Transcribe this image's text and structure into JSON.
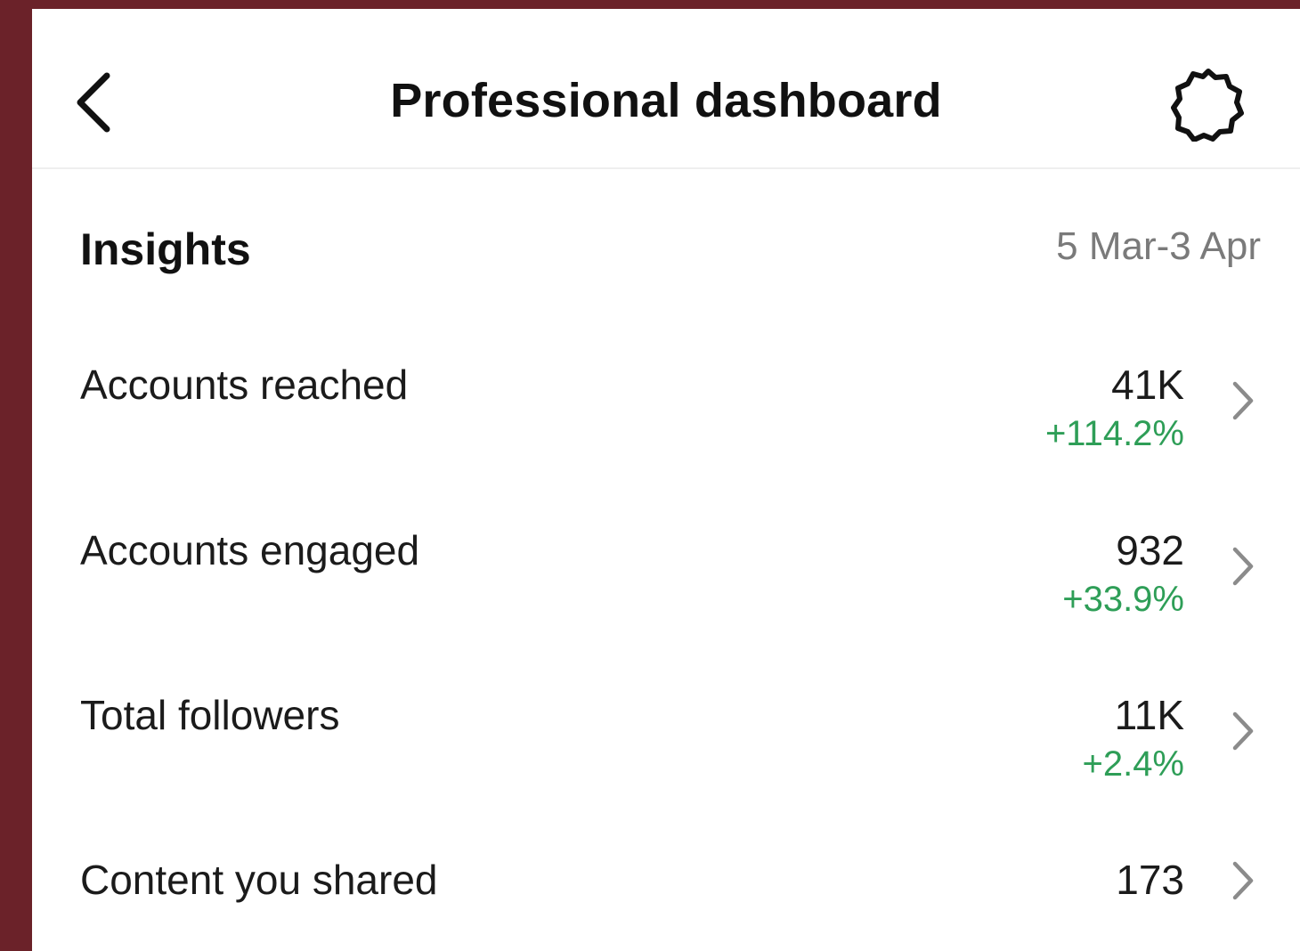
{
  "header": {
    "title": "Professional dashboard",
    "back_icon": "chevron-left-icon",
    "settings_icon": "gear-icon"
  },
  "insights": {
    "title": "Insights",
    "date_range": "5 Mar-3 Apr",
    "items": [
      {
        "label": "Accounts reached",
        "value": "41K",
        "change": "+114.2%"
      },
      {
        "label": "Accounts engaged",
        "value": "932",
        "change": "+33.9%"
      },
      {
        "label": "Total followers",
        "value": "11K",
        "change": "+2.4%"
      },
      {
        "label": "Content you shared",
        "value": "173",
        "change": ""
      }
    ]
  },
  "colors": {
    "positive_change": "#2e9e57",
    "frame": "#6b2229"
  }
}
